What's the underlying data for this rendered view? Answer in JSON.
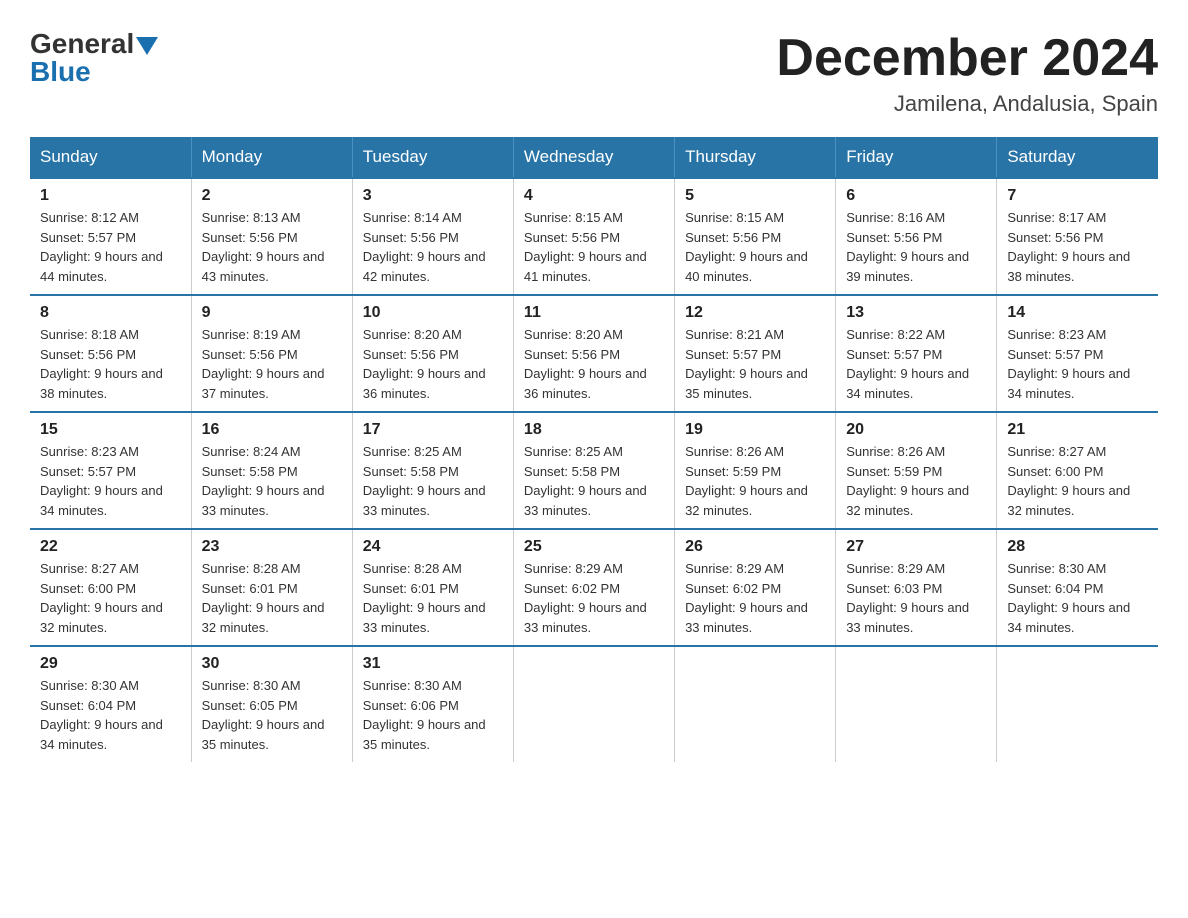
{
  "logo": {
    "general": "General",
    "blue": "Blue",
    "arrow": "▼"
  },
  "title": {
    "month": "December 2024",
    "location": "Jamilena, Andalusia, Spain"
  },
  "weekdays": [
    "Sunday",
    "Monday",
    "Tuesday",
    "Wednesday",
    "Thursday",
    "Friday",
    "Saturday"
  ],
  "weeks": [
    [
      {
        "day": "1",
        "sunrise": "8:12 AM",
        "sunset": "5:57 PM",
        "daylight": "9 hours and 44 minutes."
      },
      {
        "day": "2",
        "sunrise": "8:13 AM",
        "sunset": "5:56 PM",
        "daylight": "9 hours and 43 minutes."
      },
      {
        "day": "3",
        "sunrise": "8:14 AM",
        "sunset": "5:56 PM",
        "daylight": "9 hours and 42 minutes."
      },
      {
        "day": "4",
        "sunrise": "8:15 AM",
        "sunset": "5:56 PM",
        "daylight": "9 hours and 41 minutes."
      },
      {
        "day": "5",
        "sunrise": "8:15 AM",
        "sunset": "5:56 PM",
        "daylight": "9 hours and 40 minutes."
      },
      {
        "day": "6",
        "sunrise": "8:16 AM",
        "sunset": "5:56 PM",
        "daylight": "9 hours and 39 minutes."
      },
      {
        "day": "7",
        "sunrise": "8:17 AM",
        "sunset": "5:56 PM",
        "daylight": "9 hours and 38 minutes."
      }
    ],
    [
      {
        "day": "8",
        "sunrise": "8:18 AM",
        "sunset": "5:56 PM",
        "daylight": "9 hours and 38 minutes."
      },
      {
        "day": "9",
        "sunrise": "8:19 AM",
        "sunset": "5:56 PM",
        "daylight": "9 hours and 37 minutes."
      },
      {
        "day": "10",
        "sunrise": "8:20 AM",
        "sunset": "5:56 PM",
        "daylight": "9 hours and 36 minutes."
      },
      {
        "day": "11",
        "sunrise": "8:20 AM",
        "sunset": "5:56 PM",
        "daylight": "9 hours and 36 minutes."
      },
      {
        "day": "12",
        "sunrise": "8:21 AM",
        "sunset": "5:57 PM",
        "daylight": "9 hours and 35 minutes."
      },
      {
        "day": "13",
        "sunrise": "8:22 AM",
        "sunset": "5:57 PM",
        "daylight": "9 hours and 34 minutes."
      },
      {
        "day": "14",
        "sunrise": "8:23 AM",
        "sunset": "5:57 PM",
        "daylight": "9 hours and 34 minutes."
      }
    ],
    [
      {
        "day": "15",
        "sunrise": "8:23 AM",
        "sunset": "5:57 PM",
        "daylight": "9 hours and 34 minutes."
      },
      {
        "day": "16",
        "sunrise": "8:24 AM",
        "sunset": "5:58 PM",
        "daylight": "9 hours and 33 minutes."
      },
      {
        "day": "17",
        "sunrise": "8:25 AM",
        "sunset": "5:58 PM",
        "daylight": "9 hours and 33 minutes."
      },
      {
        "day": "18",
        "sunrise": "8:25 AM",
        "sunset": "5:58 PM",
        "daylight": "9 hours and 33 minutes."
      },
      {
        "day": "19",
        "sunrise": "8:26 AM",
        "sunset": "5:59 PM",
        "daylight": "9 hours and 32 minutes."
      },
      {
        "day": "20",
        "sunrise": "8:26 AM",
        "sunset": "5:59 PM",
        "daylight": "9 hours and 32 minutes."
      },
      {
        "day": "21",
        "sunrise": "8:27 AM",
        "sunset": "6:00 PM",
        "daylight": "9 hours and 32 minutes."
      }
    ],
    [
      {
        "day": "22",
        "sunrise": "8:27 AM",
        "sunset": "6:00 PM",
        "daylight": "9 hours and 32 minutes."
      },
      {
        "day": "23",
        "sunrise": "8:28 AM",
        "sunset": "6:01 PM",
        "daylight": "9 hours and 32 minutes."
      },
      {
        "day": "24",
        "sunrise": "8:28 AM",
        "sunset": "6:01 PM",
        "daylight": "9 hours and 33 minutes."
      },
      {
        "day": "25",
        "sunrise": "8:29 AM",
        "sunset": "6:02 PM",
        "daylight": "9 hours and 33 minutes."
      },
      {
        "day": "26",
        "sunrise": "8:29 AM",
        "sunset": "6:02 PM",
        "daylight": "9 hours and 33 minutes."
      },
      {
        "day": "27",
        "sunrise": "8:29 AM",
        "sunset": "6:03 PM",
        "daylight": "9 hours and 33 minutes."
      },
      {
        "day": "28",
        "sunrise": "8:30 AM",
        "sunset": "6:04 PM",
        "daylight": "9 hours and 34 minutes."
      }
    ],
    [
      {
        "day": "29",
        "sunrise": "8:30 AM",
        "sunset": "6:04 PM",
        "daylight": "9 hours and 34 minutes."
      },
      {
        "day": "30",
        "sunrise": "8:30 AM",
        "sunset": "6:05 PM",
        "daylight": "9 hours and 35 minutes."
      },
      {
        "day": "31",
        "sunrise": "8:30 AM",
        "sunset": "6:06 PM",
        "daylight": "9 hours and 35 minutes."
      },
      null,
      null,
      null,
      null
    ]
  ]
}
